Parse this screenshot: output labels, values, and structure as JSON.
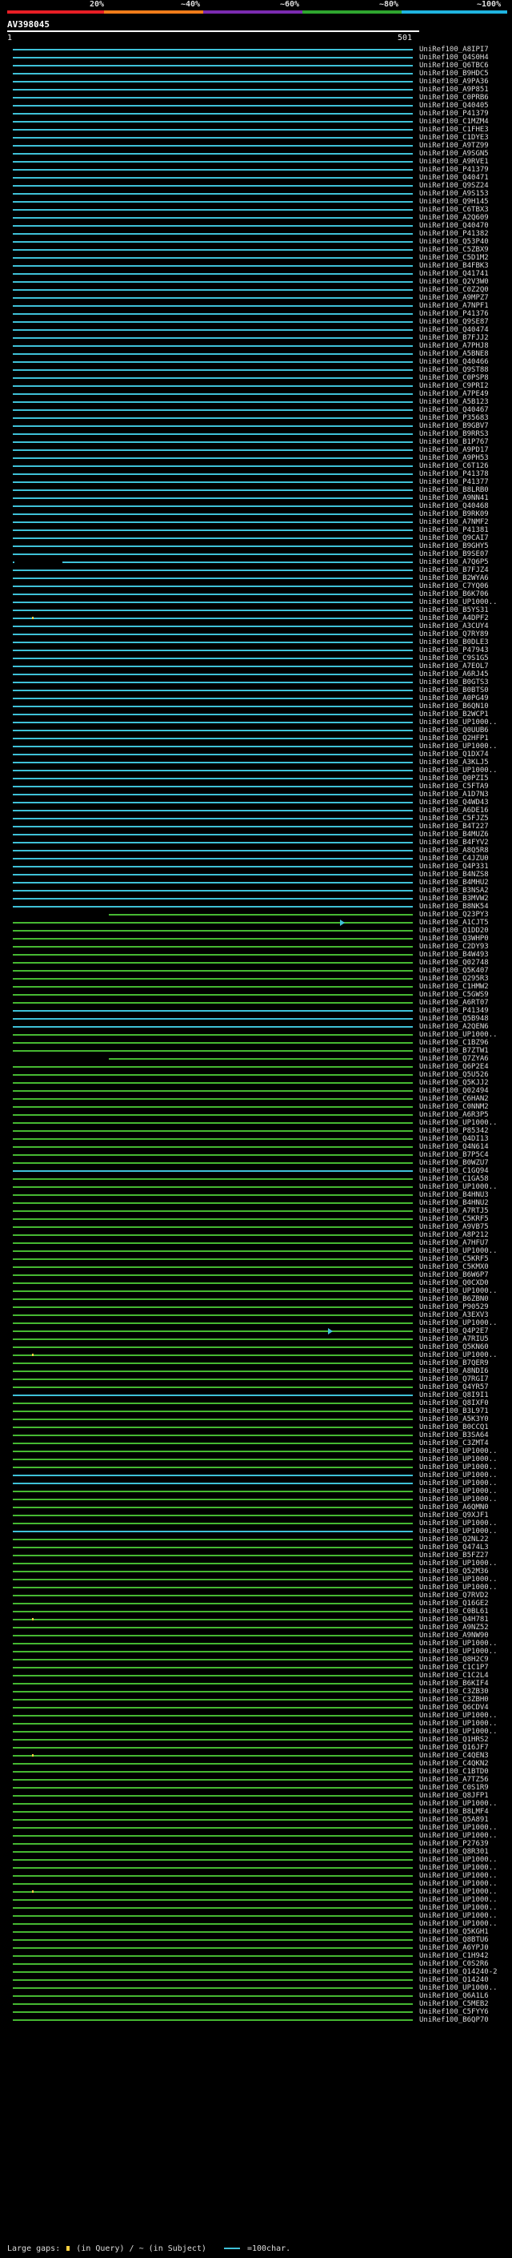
{
  "scale": {
    "labels": [
      "20%",
      "~40%",
      "~60%",
      "~80%",
      "~100%"
    ],
    "colors": [
      "#e81e25",
      "#f07c1a",
      "#7b2bb0",
      "#2fa52f",
      "#1fb4e0"
    ]
  },
  "query": {
    "id": "AV398045",
    "start": "1",
    "end": "501"
  },
  "legend": {
    "gaps_label": "Large gaps:",
    "in_query": "(in Query)",
    "sep": "/",
    "in_subject": "~ (in Subject)",
    "scale_text": "=100char."
  },
  "colors": {
    "blue": "#3fc1d8",
    "green": "#46b832",
    "gap_marker": "#ffd040"
  },
  "hits": [
    "UniRef100_A8IPI7",
    "UniRef100_Q4S0H4",
    "UniRef100_Q6TBC6",
    "UniRef100_B9HDC5",
    "UniRef100_A9PA36",
    "UniRef100_A9P851",
    "UniRef100_C0PRB6",
    "UniRef100_Q40405",
    "UniRef100_P41379",
    "UniRef100_C1MZM4",
    "UniRef100_C1FHE3",
    "UniRef100_C1DYE3",
    "UniRef100_A9TZ99",
    "UniRef100_A9SGN5",
    "UniRef100_A9RVE1",
    "UniRef100_P41379",
    "UniRef100_Q40471",
    "UniRef100_Q9SZ24",
    "UniRef100_A9S153",
    "UniRef100_Q9H145",
    "UniRef100_C6TBX3",
    "UniRef100_A2Q609",
    "UniRef100_Q40470",
    "UniRef100_P41382",
    "UniRef100_Q53P40",
    "UniRef100_C5ZBX9",
    "UniRef100_C5D1M2",
    "UniRef100_B4FBK3",
    "UniRef100_Q41741",
    "UniRef100_Q2V3W0",
    "UniRef100_C0Z2Q0",
    "UniRef100_A9MPZ7",
    "UniRef100_A7NPF1",
    "UniRef100_P41376",
    "UniRef100_Q9SE87",
    "UniRef100_Q40474",
    "UniRef100_B7FJJ2",
    "UniRef100_A7PHJ8",
    "UniRef100_A5BNE8",
    "UniRef100_Q40466",
    "UniRef100_Q9ST88",
    "UniRef100_C0PSP8",
    "UniRef100_C9PRI2",
    "UniRef100_A7PE49",
    "UniRef100_A5B123",
    "UniRef100_Q40467",
    "UniRef100_P35683",
    "UniRef100_B9GBV7",
    "UniRef100_B9RRS3",
    "UniRef100_B1P767",
    "UniRef100_A9PD17",
    "UniRef100_A9PH53",
    "UniRef100_C6T126",
    "UniRef100_P41378",
    "UniRef100_P41377",
    "UniRef100_B8LRB0",
    "UniRef100_A9NN41",
    "UniRef100_Q40468",
    "UniRef100_B9RK09",
    "UniRef100_A7NMF2",
    "UniRef100_P41381",
    "UniRef100_Q9CAI7",
    "UniRef100_B9GHY5",
    "UniRef100_B9SE07",
    "UniRef100_A7Q6P5",
    "UniRef100_B7FJZ4",
    "UniRef100_B2WYA6",
    "UniRef100_C7YQ06",
    "UniRef100_B6K706",
    "UniRef100_UP1000..",
    "UniRef100_B5YS31",
    "UniRef100_A4DPF2",
    "UniRef100_A3CUY4",
    "UniRef100_Q7RY89",
    "UniRef100_B0DLE3",
    "UniRef100_P47943",
    "UniRef100_C9S1G5",
    "UniRef100_A7EOL7",
    "UniRef100_A6RJ45",
    "UniRef100_B0GTS3",
    "UniRef100_B0BTS0",
    "UniRef100_A0PG49",
    "UniRef100_B6QN10",
    "UniRef100_B2WCP1",
    "UniRef100_UP1000..",
    "UniRef100_Q0UUB6",
    "UniRef100_Q2HFP1",
    "UniRef100_UP1000..",
    "UniRef100_Q1DX74",
    "UniRef100_A3KLJ5",
    "UniRef100_UP1000..",
    "UniRef100_Q0PZI5",
    "UniRef100_C5FTA9",
    "UniRef100_A1D7N3",
    "UniRef100_Q4WD43",
    "UniRef100_A6DE16",
    "UniRef100_C5FJZ5",
    "UniRef100_B4T227",
    "UniRef100_B4MUZ6",
    "UniRef100_B4FYV2",
    "UniRef100_A8Q5R8",
    "UniRef100_C4JZU0",
    "UniRef100_Q4P331",
    "UniRef100_B4NZS8",
    "UniRef100_B4MHU2",
    "UniRef100_B3NSA2",
    "UniRef100_B3MVW2",
    "UniRef100_B8NK54",
    "UniRef100_Q23PY3",
    "UniRef100_A1CJT5",
    "UniRef100_Q1DD20",
    "UniRef100_Q3WHP0",
    "UniRef100_C2DY93",
    "UniRef100_B4W493",
    "UniRef100_Q02748",
    "UniRef100_Q5K407",
    "UniRef100_Q295R3",
    "UniRef100_C1HMW2",
    "UniRef100_C5GWS9",
    "UniRef100_A6RT07",
    "UniRef100_P41349",
    "UniRef100_Q5B948",
    "UniRef100_A2QEN6",
    "UniRef100_UP1000..",
    "UniRef100_C1BZ96",
    "UniRef100_B7ZTW1",
    "UniRef100_Q7ZYA6",
    "UniRef100_Q6P2E4",
    "UniRef100_Q5U526",
    "UniRef100_Q5KJJ2",
    "UniRef100_Q02494",
    "UniRef100_C6HAN2",
    "UniRef100_C0NNM2",
    "UniRef100_A6R3P5",
    "UniRef100_UP1000..",
    "UniRef100_P85342",
    "UniRef100_Q4DI13",
    "UniRef100_Q4N614",
    "UniRef100_B7P5C4",
    "UniRef100_B0WZU7",
    "UniRef100_C1GQ94",
    "UniRef100_C1GA58",
    "UniRef100_UP1000..",
    "UniRef100_B4HNU3",
    "UniRef100_B4HNU2",
    "UniRef100_A7RTJ5",
    "UniRef100_C5KRF5",
    "UniRef100_A9VB75",
    "UniRef100_A8P212",
    "UniRef100_A7HFU7",
    "UniRef100_UP1000..",
    "UniRef100_C5KRF5",
    "UniRef100_C5KMX0",
    "UniRef100_B6W6P7",
    "UniRef100_Q0CXD0",
    "UniRef100_UP1000..",
    "UniRef100_B6ZBN0",
    "UniRef100_P90529",
    "UniRef100_A3EXV3",
    "UniRef100_UP1000..",
    "UniRef100_Q4P2E7",
    "UniRef100_A7RIU5",
    "UniRef100_Q5KN60",
    "UniRef100_UP1000..",
    "UniRef100_B7QER9",
    "UniRef100_A8NDI6",
    "UniRef100_Q7RGI7",
    "UniRef100_Q4YR57",
    "UniRef100_Q8I9I1",
    "UniRef100_Q8IXF0",
    "UniRef100_B3L971",
    "UniRef100_A5K3Y0",
    "UniRef100_B0CCQ1",
    "UniRef100_B3SA64",
    "UniRef100_C3ZMT4",
    "UniRef100_UP1000..",
    "UniRef100_UP1000..",
    "UniRef100_UP1000..",
    "UniRef100_UP1000..",
    "UniRef100_UP1000..",
    "UniRef100_UP1000..",
    "UniRef100_UP1000..",
    "UniRef100_A6QMN0",
    "UniRef100_Q9XJF1",
    "UniRef100_UP1000..",
    "UniRef100_UP1000..",
    "UniRef100_Q2NL22",
    "UniRef100_Q474L3",
    "UniRef100_B5FZ27",
    "UniRef100_UP1000..",
    "UniRef100_Q52M36",
    "UniRef100_UP1000..",
    "UniRef100_UP1000..",
    "UniRef100_Q7RVD2",
    "UniRef100_Q16GE2",
    "UniRef100_C0BL61",
    "UniRef100_Q4H781",
    "UniRef100_A9NZ52",
    "UniRef100_A9NW90",
    "UniRef100_UP1000..",
    "UniRef100_UP1000..",
    "UniRef100_Q8H2C9",
    "UniRef100_C1C1P7",
    "UniRef100_C1C2L4",
    "UniRef100_B6KIF4",
    "UniRef100_C3ZB30",
    "UniRef100_C3ZBH0",
    "UniRef100_Q6CDV4",
    "UniRef100_UP1000..",
    "UniRef100_UP1000..",
    "UniRef100_UP1000..",
    "UniRef100_Q1HRS2",
    "UniRef100_Q16JF7",
    "UniRef100_C4QEN3",
    "UniRef100_C4QKN2",
    "UniRef100_C1BTD0",
    "UniRef100_A7TZ56",
    "UniRef100_C0S1R9",
    "UniRef100_Q8JFP1",
    "UniRef100_UP1000..",
    "UniRef100_B8LMF4",
    "UniRef100_Q5A891",
    "UniRef100_UP1000..",
    "UniRef100_UP1000..",
    "UniRef100_P27639",
    "UniRef100_Q8R301",
    "UniRef100_UP1000..",
    "UniRef100_UP1000..",
    "UniRef100_UP1000..",
    "UniRef100_UP1000..",
    "UniRef100_UP1000..",
    "UniRef100_UP1000..",
    "UniRef100_UP1000..",
    "UniRef100_UP1000..",
    "UniRef100_UP1000..",
    "UniRef100_Q5KGH1",
    "UniRef100_Q8BTU6",
    "UniRef100_A6YPJ0",
    "UniRef100_C1H942",
    "UniRef100_C0S2R6",
    "UniRef100_Q14240-2",
    "UniRef100_Q14240",
    "UniRef100_UP1000..",
    "UniRef100_Q6A1L6",
    "UniRef100_C5MEB2",
    "UniRef100_C5FYY6",
    "UniRef100_B6QP70"
  ]
}
